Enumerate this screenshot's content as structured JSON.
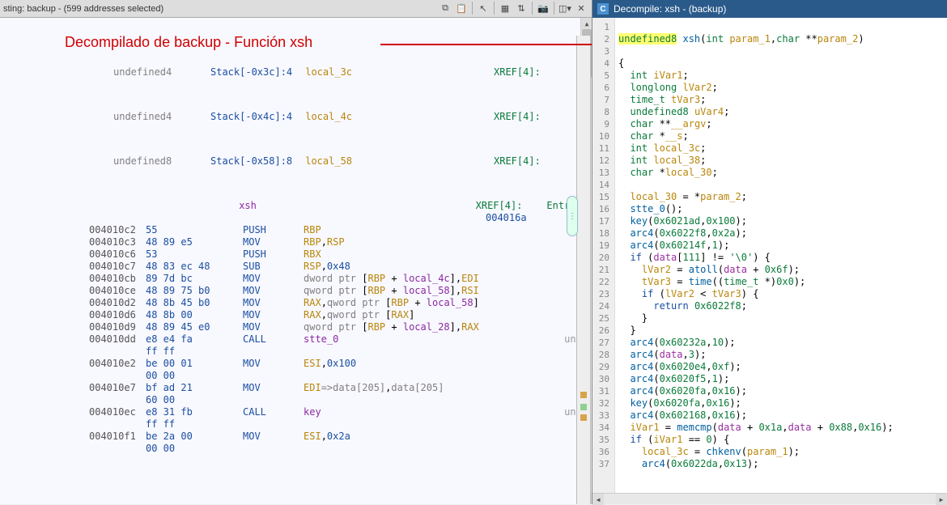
{
  "listing": {
    "title_prefix": "sting:  ",
    "title": "backup - (599 addresses selected)"
  },
  "annotation": {
    "title": "Decompilado de backup - Función xsh"
  },
  "decompile_tab": {
    "title": "Decompile: xsh - (backup)"
  },
  "vars": [
    {
      "type": "undefined4",
      "stack": "Stack[-0x3c]:4",
      "name": "local_3c",
      "xref": "XREF[4]:"
    },
    {
      "type": "undefined4",
      "stack": "Stack[-0x4c]:4",
      "name": "local_4c",
      "xref": "XREF[4]:"
    },
    {
      "type": "undefined8",
      "stack": "Stack[-0x58]:8",
      "name": "local_58",
      "xref": "XREF[4]:"
    }
  ],
  "fn_label": {
    "name": "xsh",
    "xref": "XREF[4]:",
    "extra": "Entry P",
    "extra2": "004016a"
  },
  "asm": [
    {
      "addr": "004010c2",
      "bytes": "55",
      "mnem": "PUSH",
      "ops": [
        {
          "t": "reg",
          "v": "RBP"
        }
      ]
    },
    {
      "addr": "004010c3",
      "bytes": "48 89 e5",
      "mnem": "MOV",
      "ops": [
        {
          "t": "reg",
          "v": "RBP"
        },
        {
          "t": "p",
          "v": ","
        },
        {
          "t": "reg",
          "v": "RSP"
        }
      ]
    },
    {
      "addr": "004010c6",
      "bytes": "53",
      "mnem": "PUSH",
      "ops": [
        {
          "t": "reg",
          "v": "RBX"
        }
      ]
    },
    {
      "addr": "004010c7",
      "bytes": "48 83 ec 48",
      "mnem": "SUB",
      "ops": [
        {
          "t": "reg",
          "v": "RSP"
        },
        {
          "t": "p",
          "v": ","
        },
        {
          "t": "num",
          "v": "0x48"
        }
      ]
    },
    {
      "addr": "004010cb",
      "bytes": "89 7d bc",
      "mnem": "MOV",
      "ops": [
        {
          "t": "type",
          "v": "dword ptr "
        },
        {
          "t": "p",
          "v": "["
        },
        {
          "t": "reg",
          "v": "RBP"
        },
        {
          "t": "p",
          "v": " + "
        },
        {
          "t": "local",
          "v": "local_4c"
        },
        {
          "t": "p",
          "v": "],"
        },
        {
          "t": "reg",
          "v": "EDI"
        }
      ]
    },
    {
      "addr": "004010ce",
      "bytes": "48 89 75 b0",
      "mnem": "MOV",
      "ops": [
        {
          "t": "type",
          "v": "qword ptr "
        },
        {
          "t": "p",
          "v": "["
        },
        {
          "t": "reg",
          "v": "RBP"
        },
        {
          "t": "p",
          "v": " + "
        },
        {
          "t": "local",
          "v": "local_58"
        },
        {
          "t": "p",
          "v": "],"
        },
        {
          "t": "reg",
          "v": "RSI"
        }
      ]
    },
    {
      "addr": "004010d2",
      "bytes": "48 8b 45 b0",
      "mnem": "MOV",
      "ops": [
        {
          "t": "reg",
          "v": "RAX"
        },
        {
          "t": "p",
          "v": ","
        },
        {
          "t": "type",
          "v": "qword ptr "
        },
        {
          "t": "p",
          "v": "["
        },
        {
          "t": "reg",
          "v": "RBP"
        },
        {
          "t": "p",
          "v": " + "
        },
        {
          "t": "local",
          "v": "local_58"
        },
        {
          "t": "p",
          "v": "]"
        }
      ]
    },
    {
      "addr": "004010d6",
      "bytes": "48 8b 00",
      "mnem": "MOV",
      "ops": [
        {
          "t": "reg",
          "v": "RAX"
        },
        {
          "t": "p",
          "v": ","
        },
        {
          "t": "type",
          "v": "qword ptr "
        },
        {
          "t": "p",
          "v": "["
        },
        {
          "t": "reg",
          "v": "RAX"
        },
        {
          "t": "p",
          "v": "]"
        }
      ]
    },
    {
      "addr": "004010d9",
      "bytes": "48 89 45 e0",
      "mnem": "MOV",
      "ops": [
        {
          "t": "type",
          "v": "qword ptr "
        },
        {
          "t": "p",
          "v": "["
        },
        {
          "t": "reg",
          "v": "RBP"
        },
        {
          "t": "p",
          "v": " + "
        },
        {
          "t": "local",
          "v": "local_28"
        },
        {
          "t": "p",
          "v": "],"
        },
        {
          "t": "reg",
          "v": "RAX"
        }
      ]
    },
    {
      "addr": "004010dd",
      "bytes": "e8 e4 fa",
      "mnem": "CALL",
      "ops": [
        {
          "t": "fn",
          "v": "stte_0"
        }
      ],
      "ref": "unde"
    },
    {
      "addr": "",
      "bytes": "ff ff",
      "mnem": "",
      "ops": []
    },
    {
      "addr": "004010e2",
      "bytes": "be 00 01",
      "mnem": "MOV",
      "ops": [
        {
          "t": "reg",
          "v": "ESI"
        },
        {
          "t": "p",
          "v": ","
        },
        {
          "t": "num",
          "v": "0x100"
        }
      ]
    },
    {
      "addr": "",
      "bytes": "00 00",
      "mnem": "",
      "ops": []
    },
    {
      "addr": "004010e7",
      "bytes": "bf ad 21",
      "mnem": "MOV",
      "ops": [
        {
          "t": "reg",
          "v": "EDI"
        },
        {
          "t": "label",
          "v": "=>data[205]"
        },
        {
          "t": "p",
          "v": ","
        },
        {
          "t": "label",
          "v": "data[205]"
        }
      ]
    },
    {
      "addr": "",
      "bytes": "60 00",
      "mnem": "",
      "ops": []
    },
    {
      "addr": "004010ec",
      "bytes": "e8 31 fb",
      "mnem": "CALL",
      "ops": [
        {
          "t": "fn",
          "v": "key"
        }
      ],
      "ref": "unde"
    },
    {
      "addr": "",
      "bytes": "ff ff",
      "mnem": "",
      "ops": []
    },
    {
      "addr": "004010f1",
      "bytes": "be 2a 00",
      "mnem": "MOV",
      "ops": [
        {
          "t": "reg",
          "v": "ESI"
        },
        {
          "t": "p",
          "v": ","
        },
        {
          "t": "num",
          "v": "0x2a"
        }
      ]
    },
    {
      "addr": "",
      "bytes": "00 00",
      "mnem": "",
      "ops": []
    }
  ],
  "decomp": [
    "",
    "<span class='hl'><span class='ty'>undefined8</span></span> <span class='fn2'>xsh</span>(<span class='ty'>int</span> <span class='var'>param_1</span>,<span class='ty'>char</span> **<span class='var'>param_2</span>)",
    "",
    "{",
    "  <span class='ty'>int</span> <span class='var'>iVar1</span>;",
    "  <span class='ty'>longlong</span> <span class='var'>lVar2</span>;",
    "  <span class='ty'>time_t</span> <span class='var'>tVar3</span>;",
    "  <span class='ty'>undefined8</span> <span class='var'>uVar4</span>;",
    "  <span class='ty'>char</span> **<span class='var'>__argv</span>;",
    "  <span class='ty'>char</span> *<span class='var'>__s</span>;",
    "  <span class='ty'>int</span> <span class='var'>local_3c</span>;",
    "  <span class='ty'>int</span> <span class='var'>local_38</span>;",
    "  <span class='ty'>char</span> *<span class='var'>local_30</span>;",
    "  ",
    "  <span class='var'>local_30</span> = *<span class='var'>param_2</span>;",
    "  <span class='fn2'>stte_0</span>();",
    "  <span class='fn2'>key</span>(<span class='nm'>0x6021ad</span>,<span class='nm'>0x100</span>);",
    "  <span class='fn2'>arc4</span>(<span class='nm'>0x6022f8</span>,<span class='nm'>0x2a</span>);",
    "  <span class='fn2'>arc4</span>(<span class='nm'>0x60214f</span>,<span class='nm'>1</span>);",
    "  <span class='kw'>if</span> (<span class='pur'>data</span>[<span class='nm'>111</span>] != <span class='nm'>'\\0'</span>) {",
    "    <span class='var'>lVar2</span> = <span class='fn2'>atoll</span>(<span class='pur'>data</span> + <span class='nm'>0x6f</span>);",
    "    <span class='var'>tVar3</span> = <span class='fn2'>time</span>((<span class='ty'>time_t</span> *)<span class='nm'>0x0</span>);",
    "    <span class='kw'>if</span> (<span class='var'>lVar2</span> &lt; <span class='var'>tVar3</span>) {",
    "      <span class='kw'>return</span> <span class='nm'>0x6022f8</span>;",
    "    }",
    "  }",
    "  <span class='fn2'>arc4</span>(<span class='nm'>0x60232a</span>,<span class='nm'>10</span>);",
    "  <span class='fn2'>arc4</span>(<span class='pur'>data</span>,<span class='nm'>3</span>);",
    "  <span class='fn2'>arc4</span>(<span class='nm'>0x6020e4</span>,<span class='nm'>0xf</span>);",
    "  <span class='fn2'>arc4</span>(<span class='nm'>0x6020f5</span>,<span class='nm'>1</span>);",
    "  <span class='fn2'>arc4</span>(<span class='nm'>0x6020fa</span>,<span class='nm'>0x16</span>);",
    "  <span class='fn2'>key</span>(<span class='nm'>0x6020fa</span>,<span class='nm'>0x16</span>);",
    "  <span class='fn2'>arc4</span>(<span class='nm'>0x602168</span>,<span class='nm'>0x16</span>);",
    "  <span class='var'>iVar1</span> = <span class='fn2'>memcmp</span>(<span class='pur'>data</span> + <span class='nm'>0x1a</span>,<span class='pur'>data</span> + <span class='nm'>0x88</span>,<span class='nm'>0x16</span>);",
    "  <span class='kw'>if</span> (<span class='var'>iVar1</span> == <span class='nm'>0</span>) {",
    "    <span class='var'>local_3c</span> = <span class='fn2'>chkenv</span>(<span class='var'>param_1</span>);",
    "    <span class='fn2'>arc4</span>(<span class='nm'>0x6022da</span>,<span class='nm'>0x13</span>);"
  ]
}
